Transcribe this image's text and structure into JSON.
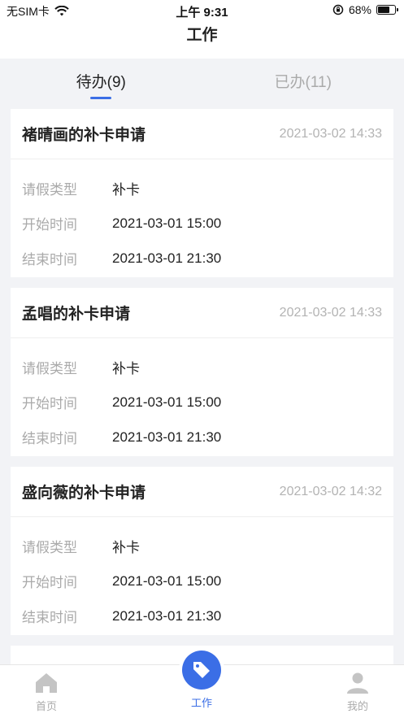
{
  "status_bar": {
    "carrier": "无SIM卡",
    "time": "上午 9:31",
    "battery": "68%",
    "battery_level": 0.68
  },
  "nav": {
    "title": "工作"
  },
  "tabs": [
    {
      "label": "待办(9)",
      "active": true
    },
    {
      "label": "已办(11)",
      "active": false
    }
  ],
  "cards": [
    {
      "title": "褚晴画的补卡申请",
      "time": "2021-03-02 14:33",
      "rows": [
        {
          "label": "请假类型",
          "value": "补卡"
        },
        {
          "label": "开始时间",
          "value": "2021-03-01 15:00"
        },
        {
          "label": "结束时间",
          "value": "2021-03-01 21:30"
        }
      ]
    },
    {
      "title": "孟唱的补卡申请",
      "time": "2021-03-02 14:33",
      "rows": [
        {
          "label": "请假类型",
          "value": "补卡"
        },
        {
          "label": "开始时间",
          "value": "2021-03-01 15:00"
        },
        {
          "label": "结束时间",
          "value": "2021-03-01 21:30"
        }
      ]
    },
    {
      "title": "盛向薇的补卡申请",
      "time": "2021-03-02 14:32",
      "rows": [
        {
          "label": "请假类型",
          "value": "补卡"
        },
        {
          "label": "开始时间",
          "value": "2021-03-01 15:00"
        },
        {
          "label": "结束时间",
          "value": "2021-03-01 21:30"
        }
      ]
    }
  ],
  "tabbar": {
    "home": "首页",
    "work": "工作",
    "me": "我的",
    "accent": "#3b6ee6"
  },
  "icons": [
    "wifi-icon",
    "orientation-lock-icon",
    "battery-icon",
    "home-icon",
    "tag-icon",
    "user-icon"
  ]
}
